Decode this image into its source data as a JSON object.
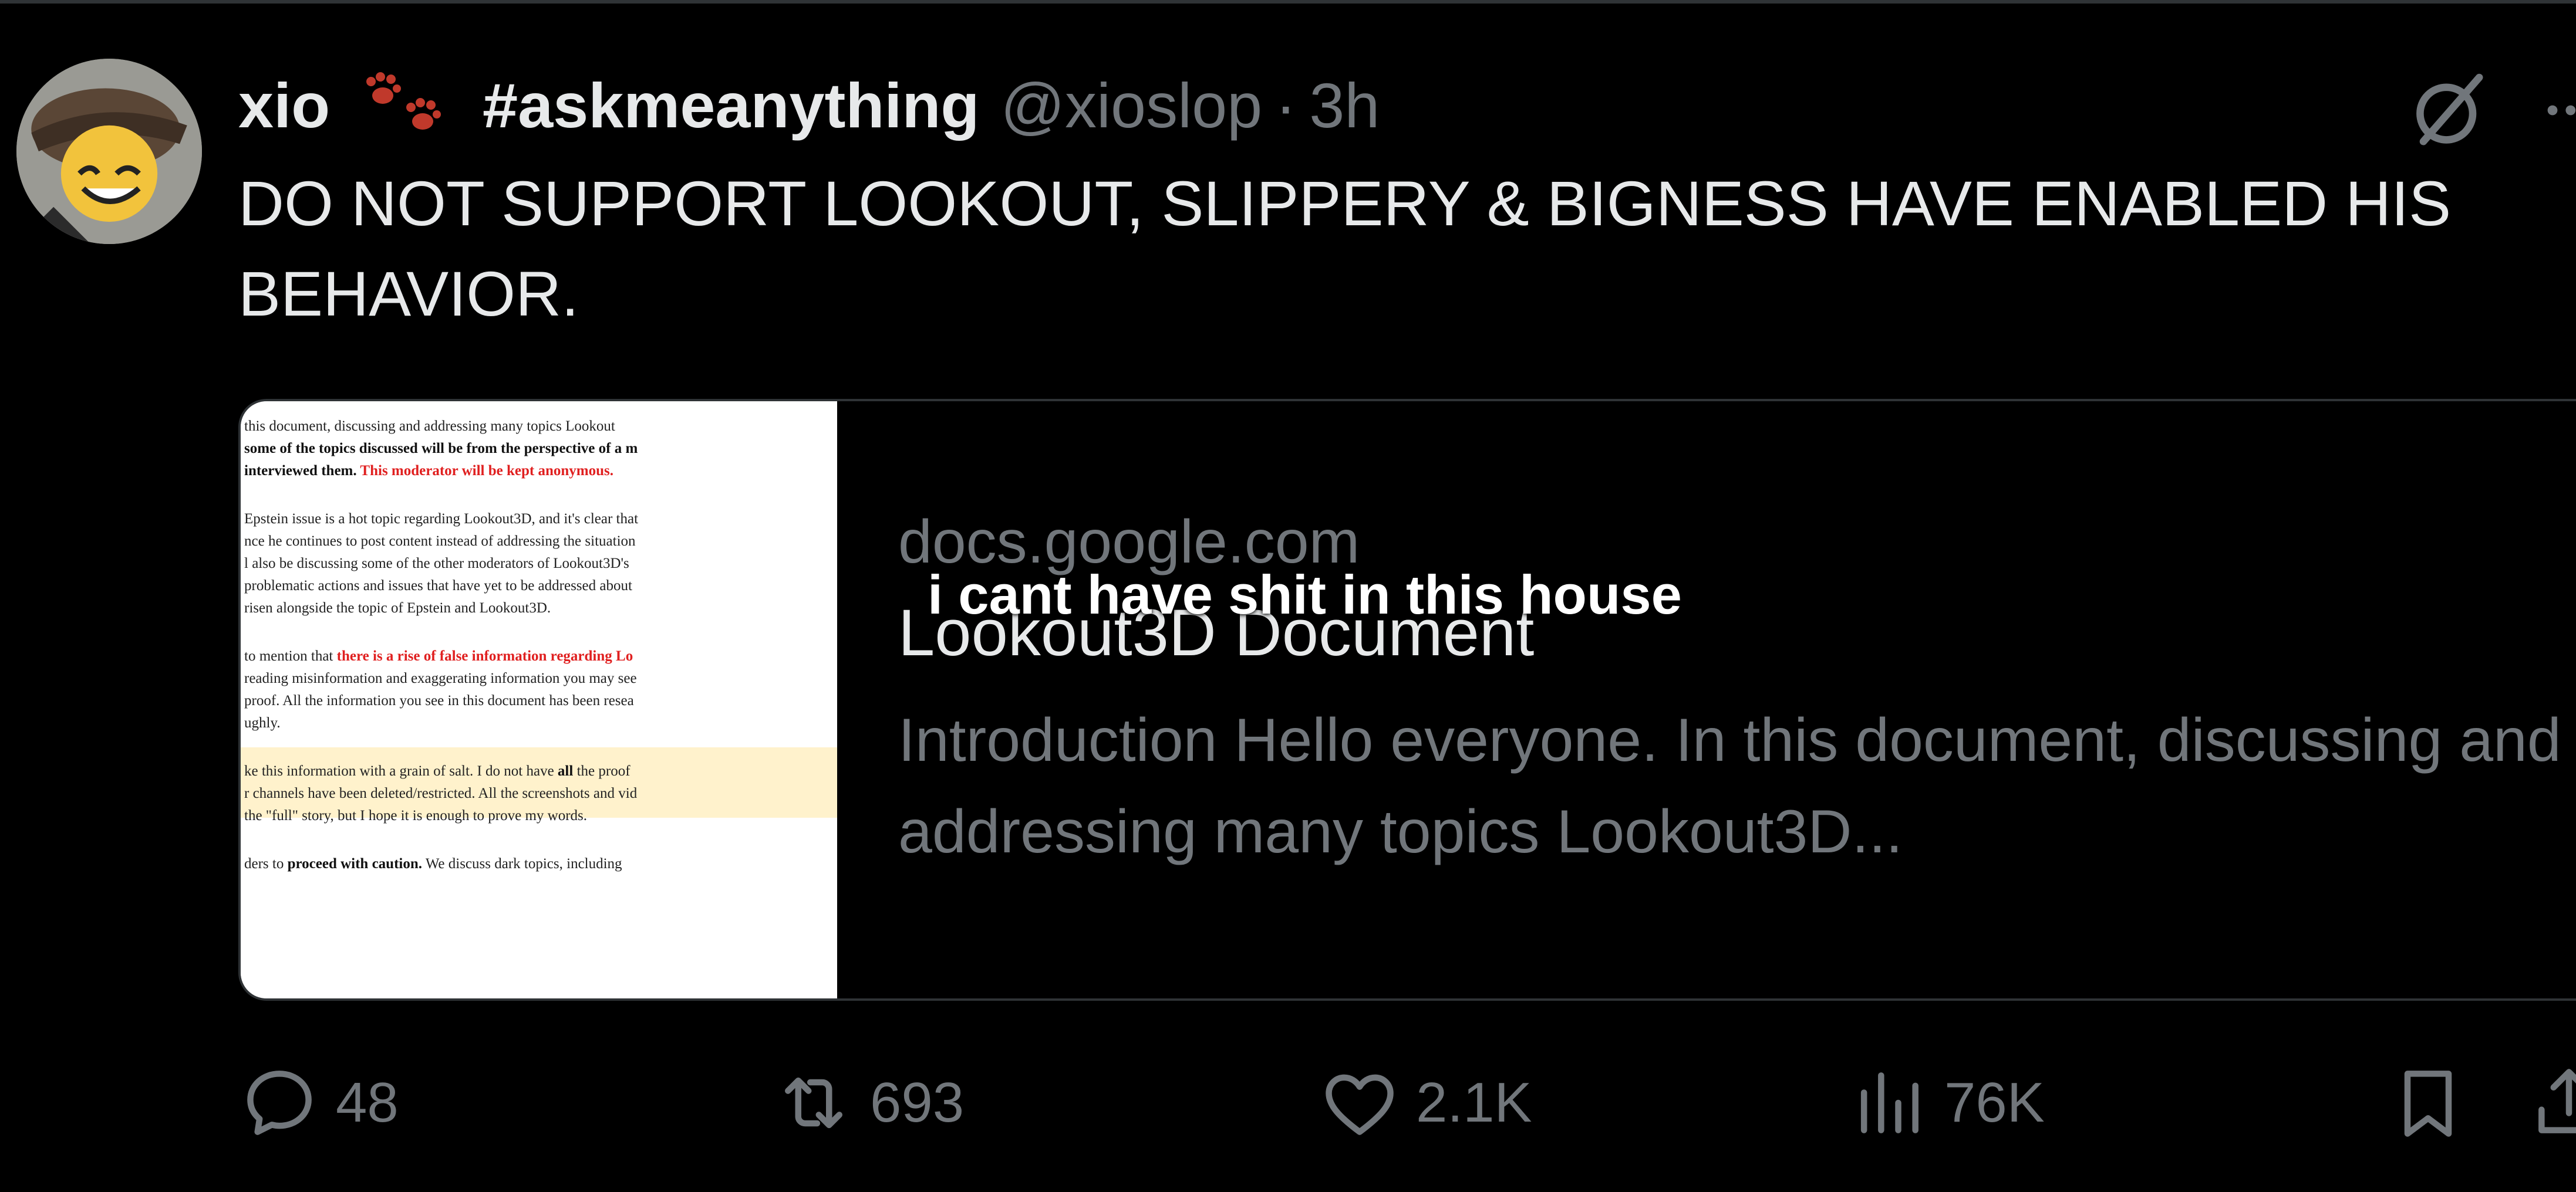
{
  "tweet": {
    "author_name": "xio",
    "name_emoji": "paw-prints-icon",
    "hashtag": "#askmeanything",
    "handle": "@xioslop",
    "separator": "·",
    "time": "3h",
    "text": "DO NOT SUPPORT LOOKOUT, SLIPPERY & BIGNESS HAVE ENABLED HIS BEHAVIOR."
  },
  "card": {
    "domain": "docs.google.com",
    "title": "Lookout3D Document",
    "description": "Introduction Hello everyone. In this document, discussing and addressing many topics Lookout3D...",
    "thumbnail_lines": [
      "this document, discussing and addressing many topics Lookout",
      "some of the topics discussed will be from the perspective of a m",
      "interviewed them.",
      "This moderator will be kept anonymous.",
      "Epstein issue is a hot topic regarding Lookout3D, and it's clear that",
      "nce he continues to post content instead of addressing the situation",
      "l also be discussing some of the other moderators of Lookout3D's",
      "problematic actions and issues that have yet to be addressed about",
      "risen alongside the topic of Epstein and Lookout3D.",
      "to mention that",
      "there is a rise of false information regarding Lo",
      "reading misinformation and exaggerating information you may see",
      "proof. All the information you see in this document has been resea",
      "ughly.",
      "ke this information with a grain of salt.",
      "I do not have",
      "all",
      "the proof",
      "r channels have been deleted/restricted. All the screenshots and vid",
      "the \"full\" story, but I hope it is enough to prove my words.",
      "ders to",
      "proceed with caution.",
      "We discuss dark topics, including"
    ]
  },
  "overlay_caption": "i cant have shit in this house",
  "actions": {
    "replies": "48",
    "reposts": "693",
    "likes": "2.1K",
    "views": "76K"
  },
  "colors": {
    "background": "#000000",
    "text": "#e7e9ea",
    "muted": "#71767b",
    "border": "#2f3336",
    "doc_red": "#e02020",
    "doc_highlight": "#fff2cc"
  }
}
